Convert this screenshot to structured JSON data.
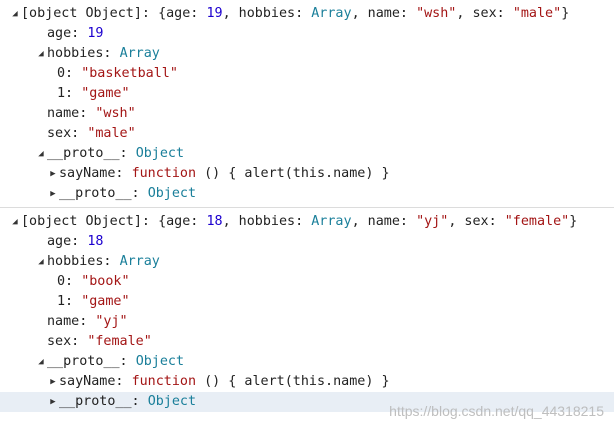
{
  "entries": [
    {
      "header": {
        "label": "[object Object]: ",
        "summary_open": "{",
        "age_key": "age: ",
        "age": "19",
        "hobbies_key": ", hobbies: ",
        "hobbies_type": "Array",
        "name_key": ", name: ",
        "name": "\"wsh\"",
        "sex_key": ", sex: ",
        "sex": "\"male\"",
        "summary_close": "}"
      },
      "age_label": "age: ",
      "age_value": "19",
      "hobbies_label": "hobbies: ",
      "hobbies_type": "Array",
      "hobbies_items": [
        {
          "index": "0: ",
          "value": "\"basketball\""
        },
        {
          "index": "1: ",
          "value": "\"game\""
        }
      ],
      "name_label": "name: ",
      "name_value": "\"wsh\"",
      "sex_label": "sex: ",
      "sex_value": "\"male\"",
      "proto_label": "__proto__: ",
      "proto_type": "Object",
      "sayname_label": "sayName: ",
      "sayname_keyword": "function ",
      "sayname_body": "() { alert(this.name) }",
      "inner_proto_label": "__proto__: ",
      "inner_proto_type": "Object"
    },
    {
      "header": {
        "label": "[object Object]: ",
        "summary_open": "{",
        "age_key": "age: ",
        "age": "18",
        "hobbies_key": ", hobbies: ",
        "hobbies_type": "Array",
        "name_key": ", name: ",
        "name": "\"yj\"",
        "sex_key": ", sex: ",
        "sex": "\"female\"",
        "summary_close": "}"
      },
      "age_label": "age: ",
      "age_value": "18",
      "hobbies_label": "hobbies: ",
      "hobbies_type": "Array",
      "hobbies_items": [
        {
          "index": "0: ",
          "value": "\"book\""
        },
        {
          "index": "1: ",
          "value": "\"game\""
        }
      ],
      "name_label": "name: ",
      "name_value": "\"yj\"",
      "sex_label": "sex: ",
      "sex_value": "\"female\"",
      "proto_label": "__proto__: ",
      "proto_type": "Object",
      "sayname_label": "sayName: ",
      "sayname_keyword": "function ",
      "sayname_body": "() { alert(this.name) }",
      "inner_proto_label": "__proto__: ",
      "inner_proto_type": "Object"
    }
  ],
  "icons": {
    "expanded": "triangle-down-icon",
    "collapsed": "triangle-right-icon"
  },
  "watermark": "https://blog.csdn.net/qq_44318215"
}
